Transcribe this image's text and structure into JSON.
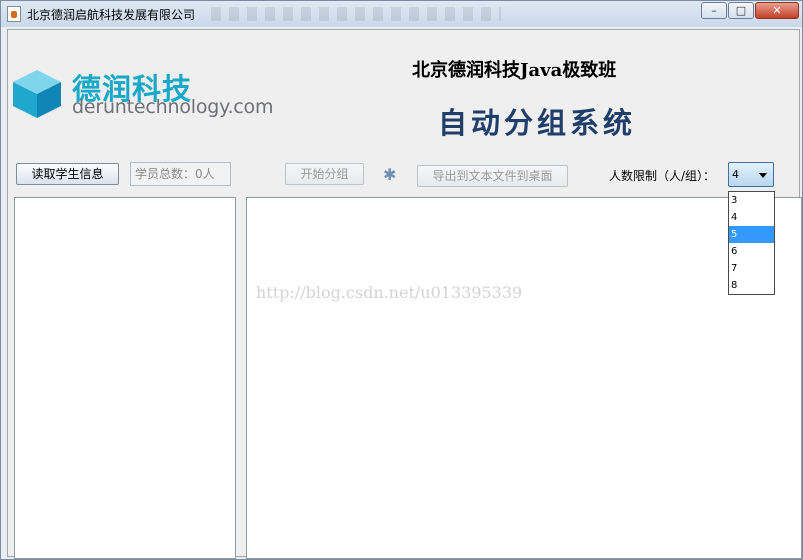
{
  "window": {
    "title": "北京德润启航科技发展有限公司",
    "min_symbol": "–",
    "max_symbol": "□",
    "close_symbol": "✕"
  },
  "logo": {
    "cn": "德润科技",
    "en": "deruntechnology.com",
    "colors": {
      "primary": "#18a8c8",
      "secondary": "#6f7175"
    }
  },
  "header": {
    "line1": "北京德润科技Java极致班",
    "line2": "自动分组系统",
    "color": "#1f3f6a"
  },
  "toolbar": {
    "read_students_label": "读取学生信息",
    "student_total": "学员总数：0人",
    "start_group_label": "开始分组",
    "spinner_glyph": "✱",
    "export_label": "导出到文本文件到桌面",
    "limit_label": "人数限制（人/组）：",
    "limit_selected": "4",
    "limit_options": [
      "3",
      "4",
      "5",
      "6",
      "7",
      "8"
    ],
    "limit_highlighted": "5"
  },
  "watermark": "http://blog.csdn.net/u013395339",
  "accent": "#3399ff"
}
